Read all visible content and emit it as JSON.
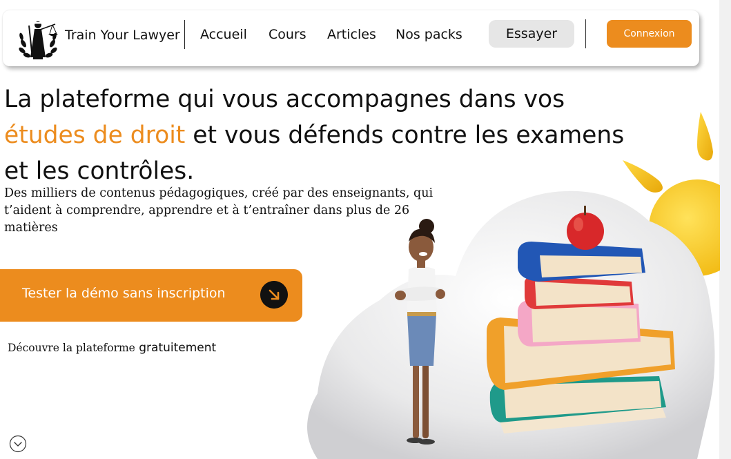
{
  "nav": {
    "brand": "Train Your Lawyer",
    "links": [
      "Accueil",
      "Cours",
      "Articles",
      "Nos packs"
    ],
    "try_label": "Essayer",
    "login_label": "Connexion"
  },
  "hero": {
    "headline_part1": "La plateforme qui vous accompagnes dans vos",
    "headline_accent": "études de droit",
    "headline_part2": "et vous défends contre les examens et les contrôles.",
    "subtitle": "Des milliers de contenus pédagogiques, créé par des enseignants, qui t’aident à comprendre, apprendre et à t’entraîner dans plus de 26 matières",
    "cta_label": "Tester la démo sans inscription",
    "discover_prefix": "Découvre la plateforme",
    "discover_emphasis": "gratuitement"
  },
  "icons": {
    "logo": "scales-of-justice-logo",
    "cta_arrow": "arrow-down-right-icon",
    "scroll": "chevron-down-circle-icon"
  },
  "colors": {
    "accent": "#ec8c1e",
    "try_button_bg": "#e6e6e6",
    "text": "#111111"
  }
}
